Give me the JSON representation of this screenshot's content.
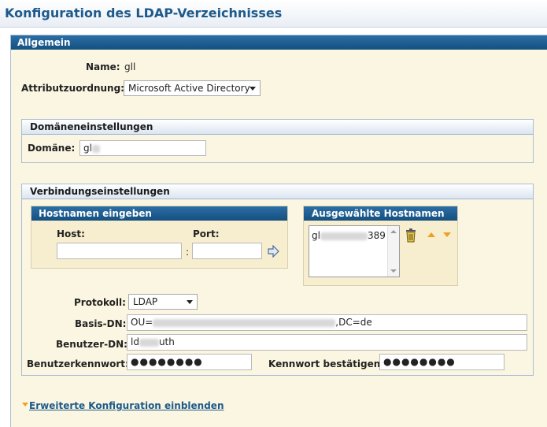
{
  "header": {
    "title": "Konfiguration des LDAP-Verzeichnisses"
  },
  "general": {
    "heading": "Allgemein",
    "name_label": "Name:",
    "name_value": "gll",
    "mapping_label": "Attributzuordnung:",
    "mapping_value": "Microsoft Active Directory"
  },
  "domain": {
    "heading": "Domäneneinstellungen",
    "label": "Domäne:",
    "value": "gl"
  },
  "connection": {
    "heading": "Verbindungseinstellungen",
    "enter_heading": "Hostnamen eingeben",
    "host_label": "Host:",
    "port_label": "Port:",
    "colon": ":",
    "selected_heading": "Ausgewählte Hostnamen",
    "selected_hosts": [
      {
        "prefix": "gl",
        "suffix": "389"
      }
    ],
    "protocol_label": "Protokoll:",
    "protocol_value": "LDAP",
    "basedn_label": "Basis-DN:",
    "basedn_prefix": "OU=",
    "basedn_suffix": ",DC=de",
    "userdn_label": "Benutzer-DN:",
    "userdn_prefix": "ld",
    "userdn_suffix": "uth",
    "password_label": "Benutzerkennwort:",
    "password_value": "●●●●●●●●",
    "confirm_label": "Kennwort bestätigen:",
    "confirm_value": "●●●●●●●●"
  },
  "footer": {
    "advanced_link": "Erweiterte Konfiguration einblenden"
  },
  "colors": {
    "header_blue": "#1d5a8c",
    "panel_bg": "#fbf6e1",
    "section_head": "#15507f",
    "arrow_orange": "#f0a020"
  },
  "icons": {
    "add": "arrow-right-icon",
    "delete": "trash-icon",
    "up": "arrow-up-icon",
    "down": "arrow-down-icon",
    "expand": "triangle-down-icon"
  }
}
